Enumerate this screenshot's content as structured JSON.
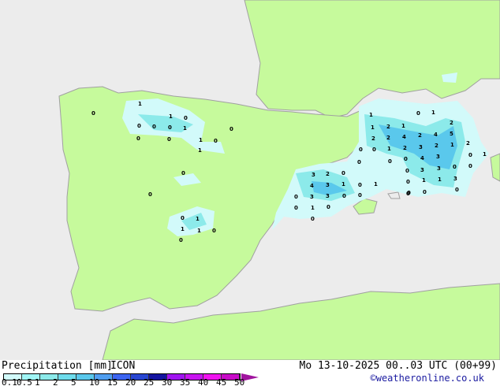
{
  "legend": {
    "title": "Precipitation [mm]",
    "model": "ICON",
    "datetime": "Mo 13-10-2025 00..03 UTC (00+99)",
    "credit": "©weatheronline.co.uk",
    "ticks": [
      "0.1",
      "0.5",
      "1",
      "2",
      "5",
      "10",
      "15",
      "20",
      "25",
      "30",
      "35",
      "40",
      "45",
      "50"
    ],
    "colors": [
      "#d2fafa",
      "#a0f5f5",
      "#8ceaea",
      "#6edcec",
      "#5ac8ec",
      "#509ef0",
      "#3c64f0",
      "#2846d2",
      "#1414a0",
      "#a014f0",
      "#c814f0",
      "#f014f0",
      "#c80ac8"
    ],
    "arrow_color": "#a0149e"
  },
  "map": {
    "land_color": "#c6fa9c",
    "sea_color": "#ececec",
    "border_color": "#a0a0a0",
    "values": [
      "0",
      "1",
      "1",
      "0",
      "0",
      "0",
      "0",
      "1",
      "0",
      "0",
      "1",
      "0",
      "1",
      "0",
      "0",
      "0",
      "0",
      "1",
      "1",
      "1",
      "0",
      "0",
      "1",
      "0",
      "1",
      "2",
      "1",
      "2",
      "1",
      "2",
      "2",
      "4",
      "2",
      "4",
      "5",
      "0",
      "0",
      "1",
      "2",
      "3",
      "2",
      "1",
      "2",
      "0",
      "0",
      "0",
      "4",
      "3",
      "0",
      "1",
      "0",
      "3",
      "3",
      "0",
      "0",
      "3",
      "2",
      "0",
      "0",
      "1",
      "1",
      "3",
      "4",
      "3",
      "1",
      "0",
      "1",
      "0",
      "0",
      "0",
      "3",
      "3",
      "0",
      "0",
      "0",
      "0",
      "0",
      "1",
      "0",
      "0"
    ]
  }
}
